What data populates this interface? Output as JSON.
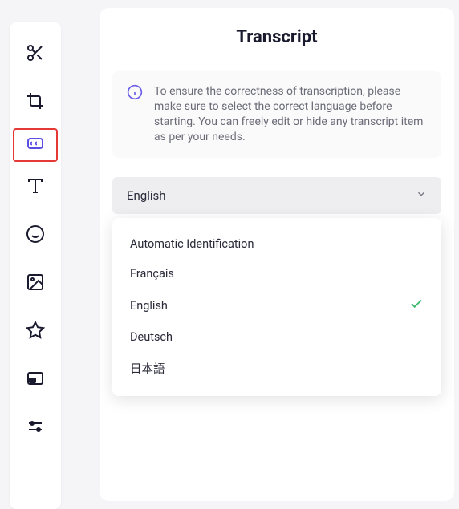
{
  "sidebar": {
    "items": [
      {
        "name": "cut"
      },
      {
        "name": "crop"
      },
      {
        "name": "subtitle",
        "highlight": true
      },
      {
        "name": "text"
      },
      {
        "name": "emoji"
      },
      {
        "name": "image"
      },
      {
        "name": "star"
      },
      {
        "name": "pip"
      },
      {
        "name": "settings"
      }
    ]
  },
  "panel": {
    "title": "Transcript",
    "info": "To ensure the correctness of transcription, please make sure to select the correct language before starting. You can freely edit or hide any transcript item as per your needs.",
    "selected_language": "English"
  },
  "dropdown": {
    "options": [
      {
        "label": "Automatic Identification",
        "selected": false
      },
      {
        "label": "Français",
        "selected": false
      },
      {
        "label": "English",
        "selected": true
      },
      {
        "label": "Deutsch",
        "selected": false
      },
      {
        "label": "日本語",
        "selected": false
      }
    ]
  }
}
